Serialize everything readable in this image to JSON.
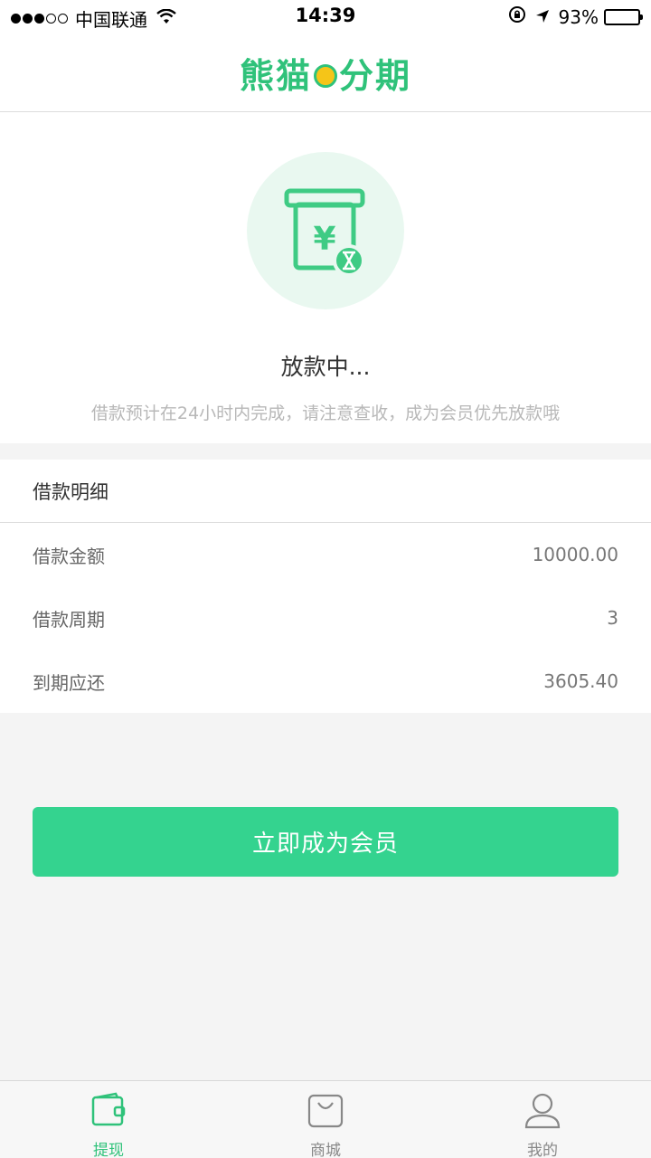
{
  "status_bar": {
    "carrier": "中国联通",
    "time": "14:39",
    "battery": "93%"
  },
  "nav": {
    "logo_text_left": "熊猫",
    "logo_text_right": "分期",
    "brand_color": "#2fc27a"
  },
  "status": {
    "icon": "atm-cash-hourglass-icon",
    "title": "放款中...",
    "description": "借款预计在24小时内完成，请注意查收，成为会员优先放款哦"
  },
  "details": {
    "header": "借款明细",
    "rows": [
      {
        "label": "借款金额",
        "value": "10000.00"
      },
      {
        "label": "借款周期",
        "value": "3"
      },
      {
        "label": "到期应还",
        "value": "3605.40"
      }
    ]
  },
  "cta": {
    "label": "立即成为会员",
    "color": "#34d38f"
  },
  "tabs": [
    {
      "label": "提现",
      "icon": "wallet-icon",
      "active": true
    },
    {
      "label": "商城",
      "icon": "shopping-bag-icon",
      "active": false
    },
    {
      "label": "我的",
      "icon": "user-icon",
      "active": false
    }
  ]
}
